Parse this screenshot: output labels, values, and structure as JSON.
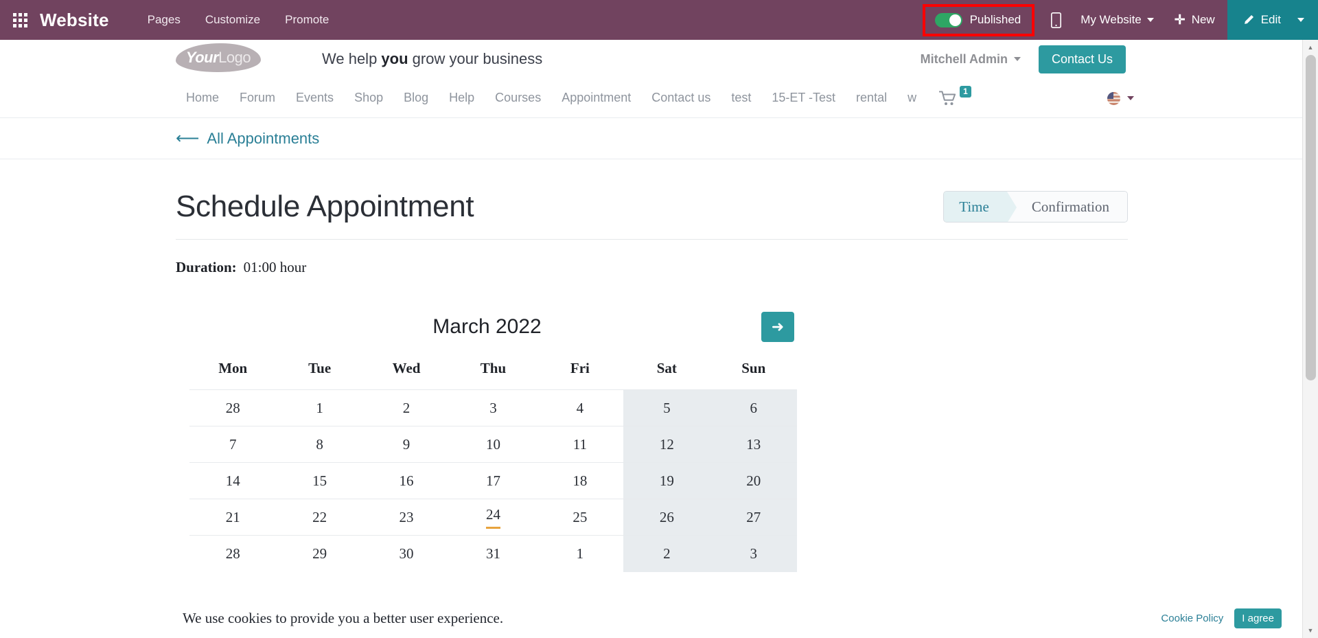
{
  "odoo_bar": {
    "apps_icon": "apps-grid-icon",
    "brand": "Website",
    "menus": [
      "Pages",
      "Customize",
      "Promote"
    ],
    "publish": {
      "label": "Published",
      "state": "on",
      "toggle_color": "#2ea664",
      "highlight_color": "#fe0000"
    },
    "mobile_preview_icon": "mobile-phone-icon",
    "my_website": "My Website",
    "new_label": "New",
    "new_icon": "plus-icon",
    "edit_label": "Edit",
    "edit_icon": "pencil-icon",
    "accent_color": "#71435f",
    "edit_button_color": "#17838d"
  },
  "site_header": {
    "logo_bold": "Your",
    "logo_light": "Logo",
    "tagline_before": "We help ",
    "tagline_bold": "you",
    "tagline_after": " grow your business",
    "user_name": "Mitchell Admin",
    "contact_button": "Contact Us"
  },
  "site_nav": {
    "links": [
      "Home",
      "Forum",
      "Events",
      "Shop",
      "Blog",
      "Help",
      "Courses",
      "Appointment",
      "Contact us",
      "test",
      "15-ET -Test",
      "rental",
      "w"
    ],
    "cart_icon": "shopping-cart-icon",
    "cart_count": "1",
    "language_icon": "flag-icon",
    "brand_color": "#2d9aa0"
  },
  "back_link": {
    "icon": "arrow-left-icon",
    "label": "All Appointments"
  },
  "main": {
    "title": "Schedule Appointment",
    "wizard": {
      "steps": [
        "Time",
        "Confirmation"
      ],
      "active": "Time"
    },
    "duration_label": "Duration:",
    "duration_value": "01:00 hour"
  },
  "calendar": {
    "month_label": "March 2022",
    "next_icon": "arrow-right-icon",
    "weekdays": [
      "Mon",
      "Tue",
      "Wed",
      "Thu",
      "Fri",
      "Sat",
      "Sun"
    ],
    "today": "24",
    "weekend_columns": [
      5,
      6
    ],
    "weeks": [
      [
        {
          "d": "28",
          "muted": true
        },
        {
          "d": "1"
        },
        {
          "d": "2"
        },
        {
          "d": "3"
        },
        {
          "d": "4"
        },
        {
          "d": "5"
        },
        {
          "d": "6"
        }
      ],
      [
        {
          "d": "7"
        },
        {
          "d": "8"
        },
        {
          "d": "9"
        },
        {
          "d": "10"
        },
        {
          "d": "11"
        },
        {
          "d": "12"
        },
        {
          "d": "13"
        }
      ],
      [
        {
          "d": "14"
        },
        {
          "d": "15"
        },
        {
          "d": "16"
        },
        {
          "d": "17"
        },
        {
          "d": "18"
        },
        {
          "d": "19"
        },
        {
          "d": "20"
        }
      ],
      [
        {
          "d": "21"
        },
        {
          "d": "22"
        },
        {
          "d": "23"
        },
        {
          "d": "24",
          "today": true
        },
        {
          "d": "25"
        },
        {
          "d": "26"
        },
        {
          "d": "27"
        }
      ],
      [
        {
          "d": "28"
        },
        {
          "d": "29"
        },
        {
          "d": "30"
        },
        {
          "d": "31"
        },
        {
          "d": "1",
          "muted": true
        },
        {
          "d": "2",
          "muted": true
        },
        {
          "d": "3",
          "muted": true
        }
      ]
    ]
  },
  "cookie_bar": {
    "text": "We use cookies to provide you a better user experience.",
    "policy_link": "Cookie Policy",
    "agree_button": "I agree"
  },
  "scrollbar": {
    "up_arrow": "chevron-up-icon",
    "down_arrow": "chevron-down-icon"
  }
}
